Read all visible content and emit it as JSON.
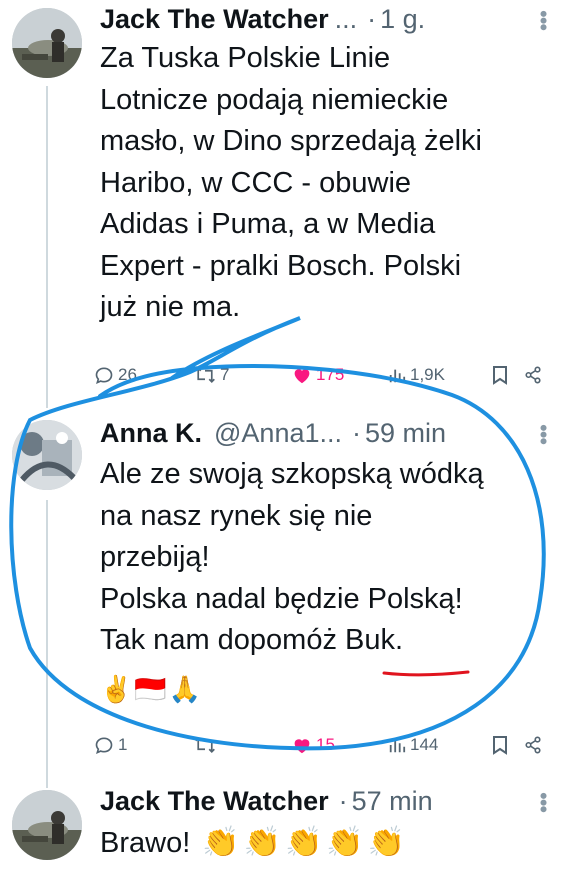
{
  "tweets": [
    {
      "name": "Jack The Watcher",
      "name_suffix": "...",
      "handle": "",
      "time": "1 g.",
      "lines": [
        "Za Tuska Polskie Linie",
        "Lotnicze podają niemieckie",
        "masło, w Dino sprzedają żelki",
        "Haribo, w CCC - obuwie",
        "Adidas i Puma, a w Media",
        "Expert - pralki Bosch. Polski",
        "już nie ma."
      ],
      "replies": "26",
      "reposts": "7",
      "likes": "175",
      "views": "1,9K"
    },
    {
      "name": "Anna K.",
      "handle": "@Anna1...",
      "time": "59 min",
      "lines": [
        "Ale ze swoją szkopską wódką",
        "na nasz rynek się nie",
        "przebiją!",
        "Polska nadal będzie Polską!",
        "Tak nam dopomóż "
      ],
      "underlined_word": "Buk",
      "after_underlined": ".",
      "emojis": [
        "✌️",
        "🇮🇩",
        "🙏"
      ],
      "replies": "1",
      "reposts": "",
      "likes": "15",
      "views": "144"
    },
    {
      "name": "Jack The Watcher",
      "handle": "",
      "time": "57 min",
      "text": "Brawo!",
      "claps": [
        "👏",
        "👏",
        "👏",
        "👏",
        "👏"
      ]
    }
  ],
  "colors": {
    "annotation_circle": "#1e90e0",
    "annotation_underline": "#e0141e",
    "like": "#f91880",
    "secondary": "#536471"
  },
  "icons": [
    "reply-icon",
    "repost-icon",
    "heart-icon",
    "views-icon",
    "bookmark-icon",
    "share-icon",
    "more-icon"
  ]
}
